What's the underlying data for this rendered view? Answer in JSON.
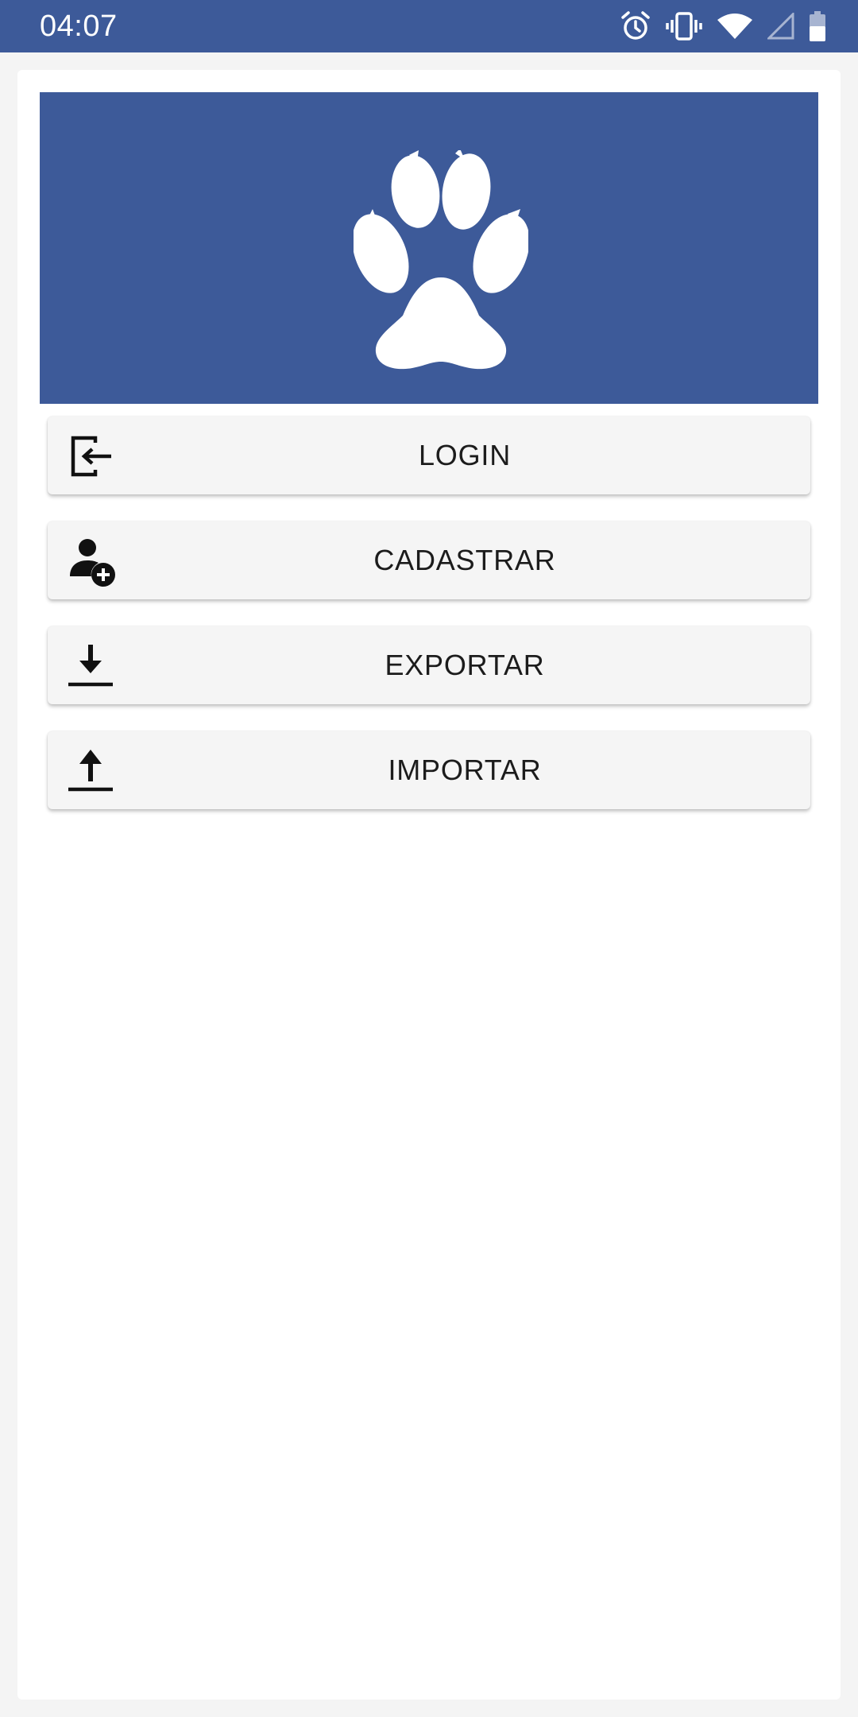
{
  "status_bar": {
    "time": "04:07",
    "icons": [
      "alarm-icon",
      "vibrate-icon",
      "wifi-icon",
      "cell-signal-icon",
      "battery-icon"
    ]
  },
  "colors": {
    "primary": "#3d5a99",
    "button_bg": "#f5f5f5",
    "text": "#1c1c1c"
  },
  "banner": {
    "logo": "paw-print-icon"
  },
  "menu": [
    {
      "label": "LOGIN",
      "icon": "login-icon"
    },
    {
      "label": "CADASTRAR",
      "icon": "add-user-icon"
    },
    {
      "label": "EXPORTAR",
      "icon": "download-icon"
    },
    {
      "label": "IMPORTAR",
      "icon": "upload-icon"
    }
  ]
}
